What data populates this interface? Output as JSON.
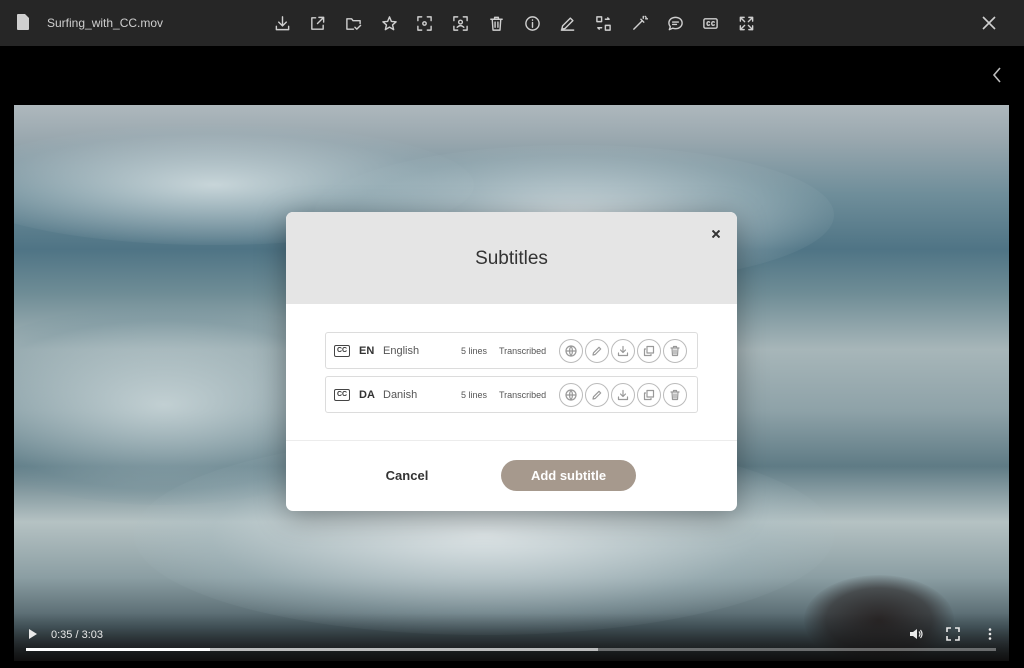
{
  "window": {
    "file_name": "Surfing_with_CC.mov",
    "toolbar_icons": [
      "download-icon",
      "share-icon",
      "folder-check-icon",
      "star-icon",
      "focus-icon",
      "person-frame-icon",
      "trash-icon",
      "info-icon",
      "pen-icon",
      "convert-icon",
      "magic-wand-icon",
      "comment-icon",
      "cc-icon",
      "expand-icon"
    ],
    "close_icon": "close-icon",
    "side_icon": "chevron-left-icon"
  },
  "player": {
    "time": "0:35 / 3:03",
    "progress_fraction": 0.19,
    "buffered_fraction": 0.59,
    "icons": [
      "play-icon",
      "volume-icon",
      "fullscreen-icon",
      "more-icon"
    ]
  },
  "modal": {
    "title": "Subtitles",
    "rows": [
      {
        "code": "EN",
        "language": "English",
        "lines": "5 lines",
        "status": "Transcribed",
        "cc": "CC"
      },
      {
        "code": "DA",
        "language": "Danish",
        "lines": "5 lines",
        "status": "Transcribed",
        "cc": "CC"
      }
    ],
    "row_actions": [
      "globe-icon",
      "edit-icon",
      "download-icon",
      "copy-icon",
      "trash-icon"
    ],
    "cancel_label": "Cancel",
    "add_label": "Add subtitle",
    "accent_color": "#a6998d"
  }
}
